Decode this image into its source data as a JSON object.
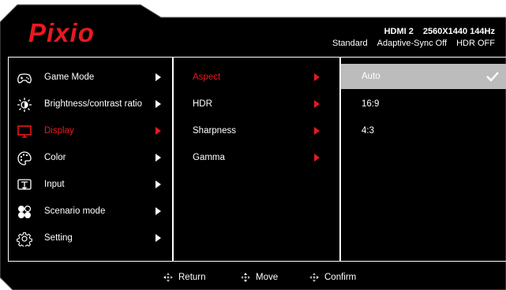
{
  "brand": "Pixio",
  "status": {
    "line1": [
      "HDMI 2",
      "2560X1440 144Hz"
    ],
    "line2": [
      "Standard",
      "Adaptive-Sync Off",
      "HDR OFF"
    ]
  },
  "main_menu": [
    {
      "label": "Game Mode",
      "icon": "gamepad-icon"
    },
    {
      "label": "Brightness/contrast ratio",
      "icon": "brightness-icon"
    },
    {
      "label": "Display",
      "icon": "monitor-icon"
    },
    {
      "label": "Color",
      "icon": "palette-icon"
    },
    {
      "label": "Input",
      "icon": "input-icon"
    },
    {
      "label": "Scenario mode",
      "icon": "scenario-icon"
    },
    {
      "label": "Setting",
      "icon": "gear-icon"
    }
  ],
  "active_main_item": "Display",
  "sub_menu": [
    {
      "label": "Aspect"
    },
    {
      "label": "HDR"
    },
    {
      "label": "Sharpness"
    },
    {
      "label": "Gamma"
    }
  ],
  "active_sub_item": "Aspect",
  "options": [
    {
      "label": "Auto"
    },
    {
      "label": "16:9"
    },
    {
      "label": "4:3"
    }
  ],
  "selected_option": "Auto",
  "footer": {
    "return_label": "Return",
    "move_label": "Move",
    "confirm_label": "Confirm"
  },
  "colors": {
    "accent": "#e8191f",
    "background": "#000000",
    "selected_bg": "#bcbcbc",
    "text": "#ffffff"
  }
}
